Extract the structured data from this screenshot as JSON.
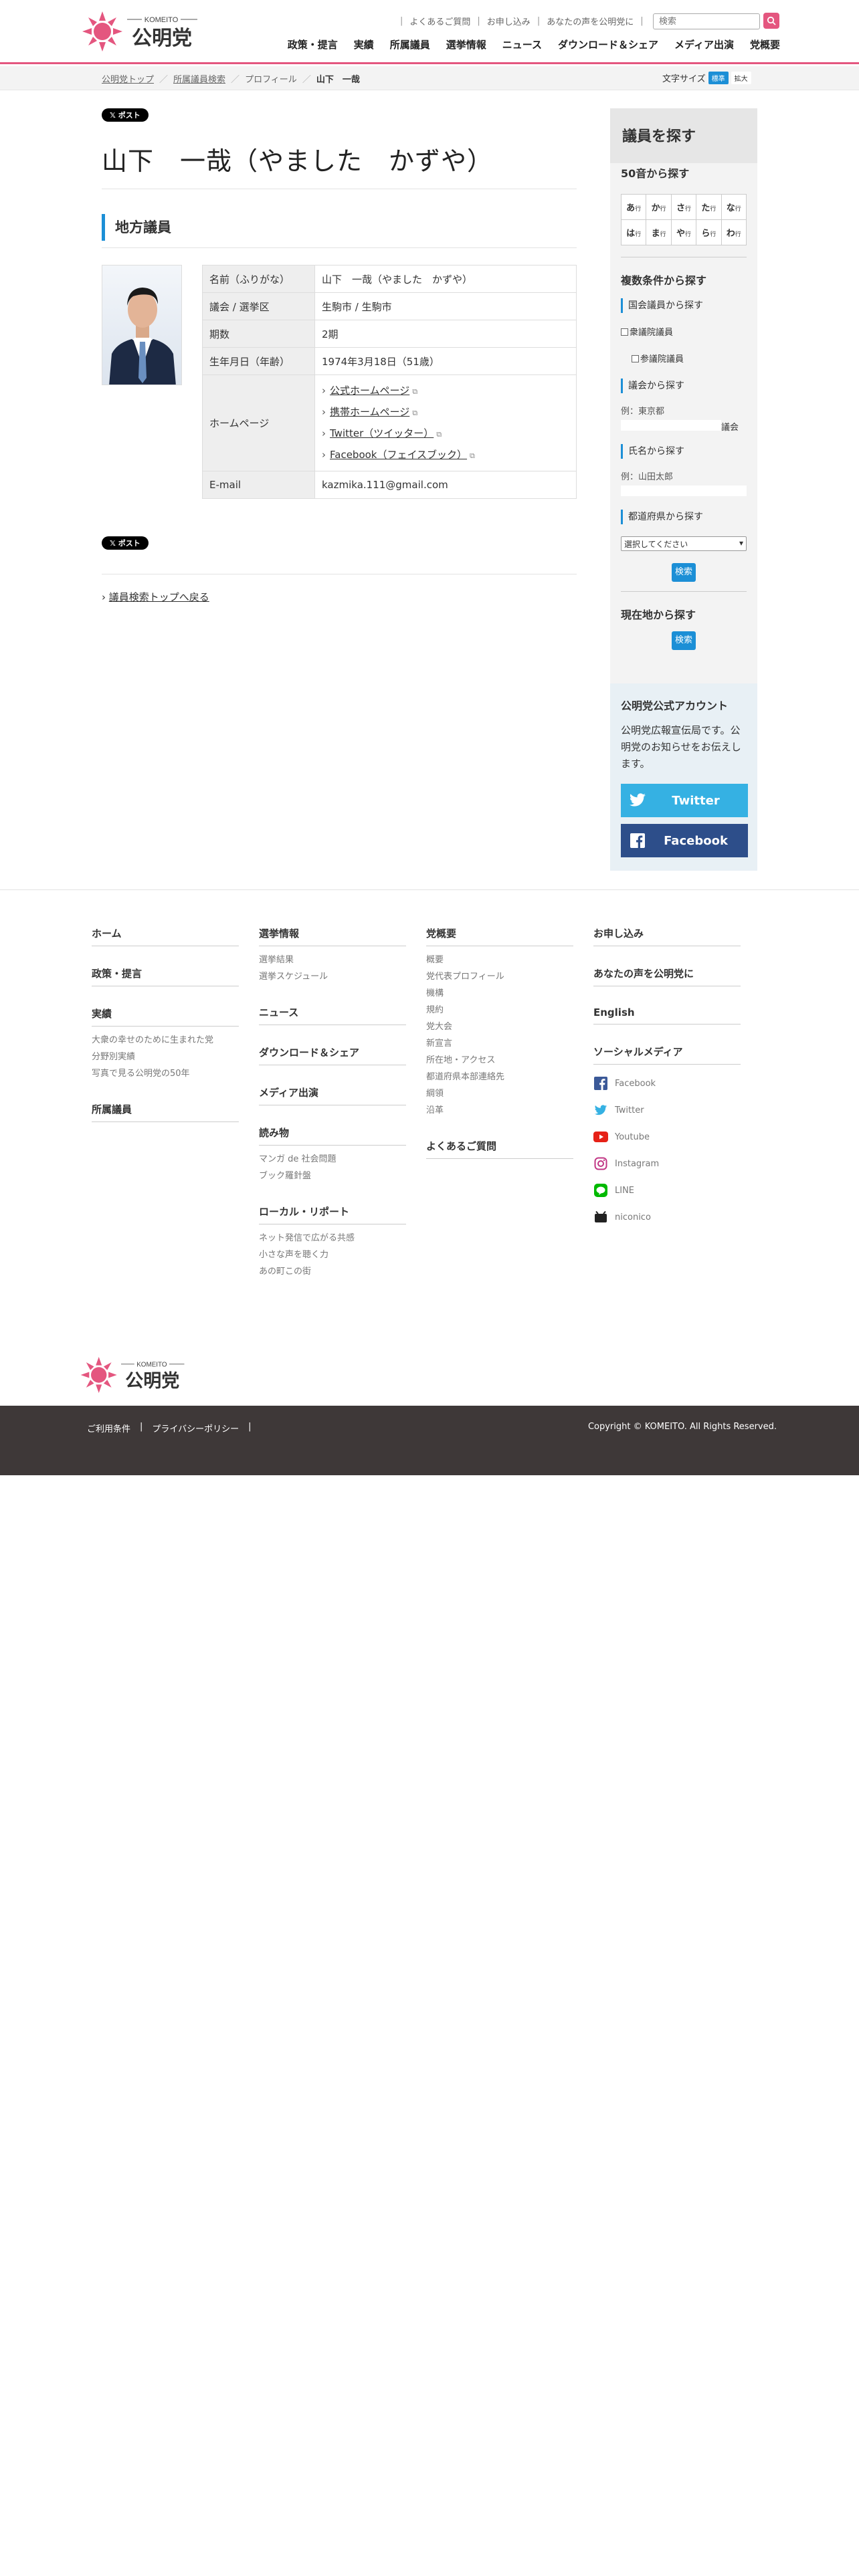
{
  "header": {
    "logo_text": "公明党",
    "logo_sub": "KOMEITO",
    "top_links": [
      "よくあるご質問",
      "お申し込み",
      "あなたの声を公明党に"
    ],
    "search_placeholder": "検索",
    "main_nav": [
      "政策・提言",
      "実績",
      "所属議員",
      "選挙情報",
      "ニュース",
      "ダウンロード＆シェア",
      "メディア出演",
      "党概要"
    ]
  },
  "breadcrumb": {
    "items": [
      "公明党トップ",
      "所属議員検索",
      "プロフィール"
    ],
    "current": "山下　一哉",
    "font_size_label": "文字サイズ",
    "font_std": "標準",
    "font_large": "拡大"
  },
  "post_label": "ポスト",
  "page_title": "山下　一哉（やました　かずや）",
  "section_title": "地方議員",
  "profile": {
    "rows": [
      {
        "label": "名前（ふりがな）",
        "value": "山下　一哉（やました　かずや）"
      },
      {
        "label": "議会 / 選挙区",
        "value": "生駒市 / 生駒市"
      },
      {
        "label": "期数",
        "value": "2期"
      },
      {
        "label": "生年月日（年齢）",
        "value": "1974年3月18日（51歳）"
      }
    ],
    "homepage_label": "ホームページ",
    "homepages": [
      "公式ホームページ",
      "携帯ホームページ",
      "Twitter（ツイッター）",
      "Facebook（フェイスブック）"
    ],
    "email_label": "E-mail",
    "email": "kazmika.111@gmail.com"
  },
  "back_link": "議員検索トップへ戻る",
  "sidebar": {
    "title": "議員を探す",
    "kana_title": "50音から探す",
    "kana": [
      [
        "あ",
        "か",
        "さ",
        "た",
        "な"
      ],
      [
        "は",
        "ま",
        "や",
        "ら",
        "わ"
      ]
    ],
    "kana_suffix": "行",
    "multi_title": "複数条件から探す",
    "national_label": "国会議員から探す",
    "shugiin": "衆議院議員",
    "sangiin": "参議院議員",
    "assembly_label": "議会から探す",
    "assembly_example": "例：東京都",
    "assembly_suffix": "議会",
    "name_label": "氏名から探す",
    "name_example": "例：山田太郎",
    "pref_label": "都道府県から探す",
    "pref_select": "選択してください",
    "search_btn": "検索",
    "location_title": "現在地から探す"
  },
  "account": {
    "title": "公明党公式アカウント",
    "text": "公明党広報宣伝局です。公明党のお知らせをお伝えします。",
    "twitter": "Twitter",
    "facebook": "Facebook"
  },
  "footer": {
    "col1": [
      {
        "head": "ホーム",
        "items": []
      },
      {
        "head": "政策・提言",
        "items": []
      },
      {
        "head": "実績",
        "items": [
          "大衆の幸せのために生まれた党",
          "分野別実績",
          "写真で見る公明党の50年"
        ]
      },
      {
        "head": "所属議員",
        "items": []
      }
    ],
    "col2": [
      {
        "head": "選挙情報",
        "items": [
          "選挙結果",
          "選挙スケジュール"
        ]
      },
      {
        "head": "ニュース",
        "items": []
      },
      {
        "head": "ダウンロード＆シェア",
        "items": []
      },
      {
        "head": "メディア出演",
        "items": []
      },
      {
        "head": "読み物",
        "items": [
          "マンガ de 社会問題",
          "ブック羅針盤"
        ]
      },
      {
        "head": "ローカル・リポート",
        "items": [
          "ネット発信で広がる共感",
          "小さな声を聴く力",
          "あの町この街"
        ]
      }
    ],
    "col3": [
      {
        "head": "党概要",
        "items": [
          "概要",
          "党代表プロフィール",
          "機構",
          "規約",
          "党大会",
          "新宣言",
          "所在地・アクセス",
          "都道府県本部連絡先",
          "綱領",
          "沿革"
        ]
      },
      {
        "head": "よくあるご質問",
        "items": []
      }
    ],
    "col4": [
      {
        "head": "お申し込み",
        "items": []
      },
      {
        "head": "あなたの声を公明党に",
        "items": []
      },
      {
        "head": "English",
        "items": []
      }
    ],
    "social_head": "ソーシャルメディア",
    "social": [
      "Facebook",
      "Twitter",
      "Youtube",
      "Instagram",
      "LINE",
      "niconico"
    ],
    "bottom_links": [
      "ご利用条件",
      "プライバシーポリシー"
    ],
    "copyright": "Copyright © KOMEITO. All Rights Reserved."
  },
  "colors": {
    "brand_pink": "#e4567f",
    "accent_blue": "#1c8fd6",
    "twitter": "#35b1e3",
    "facebook": "#2d4e8a",
    "footer_bar": "#3e3838"
  }
}
